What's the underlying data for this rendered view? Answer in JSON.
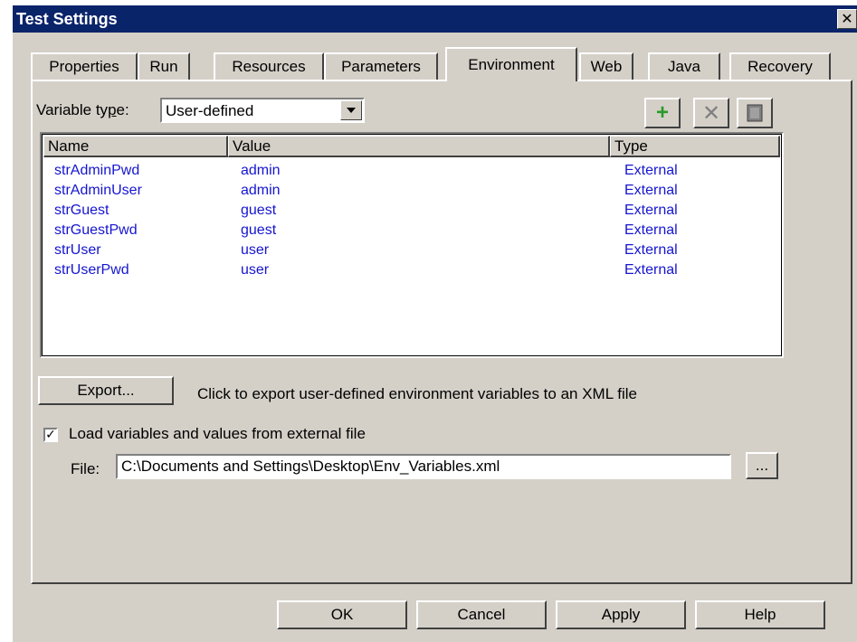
{
  "window": {
    "title": "Test Settings",
    "close_glyph": "✕"
  },
  "tabs": [
    {
      "label": "Properties",
      "active": false
    },
    {
      "label": "Run",
      "active": false
    },
    {
      "label": "Resources",
      "active": false
    },
    {
      "label": "Parameters",
      "active": false
    },
    {
      "label": "Environment",
      "active": true
    },
    {
      "label": "Web",
      "active": false
    },
    {
      "label": "Java",
      "active": false
    },
    {
      "label": "Recovery",
      "active": false
    }
  ],
  "variable_type": {
    "label_prefix": "Variable ty",
    "label_ul": "p",
    "label_suffix": "e:",
    "selected": "User-defined"
  },
  "toolbar": {
    "add_icon": "plus-icon",
    "delete_icon": "delete-icon",
    "details_icon": "details-icon"
  },
  "listview": {
    "columns": [
      "Name",
      "Value",
      "Type"
    ],
    "rows": [
      {
        "name": "strAdminPwd",
        "value": "admin",
        "type": "External"
      },
      {
        "name": "strAdminUser",
        "value": "admin",
        "type": "External"
      },
      {
        "name": "strGuest",
        "value": "guest",
        "type": "External"
      },
      {
        "name": "strGuestPwd",
        "value": "guest",
        "type": "External"
      },
      {
        "name": "strUser",
        "value": "user",
        "type": "External"
      },
      {
        "name": "strUserPwd",
        "value": "user",
        "type": "External"
      }
    ],
    "text_color": "#1515d0"
  },
  "export": {
    "label": "Export...",
    "note": "Click to export user-defined environment variables to an XML file"
  },
  "load_checkbox": {
    "checked": true,
    "label": "Load variables and values from external file"
  },
  "file": {
    "label": "File:",
    "value": "C:\\Documents and Settings\\Desktop\\Env_Variables.xml",
    "browse_label": "..."
  },
  "buttons": {
    "ok": "OK",
    "cancel": "Cancel",
    "apply": "Apply",
    "help": "Help"
  },
  "colors": {
    "title_bg": "#0a246a",
    "face": "#d4d0c8"
  }
}
